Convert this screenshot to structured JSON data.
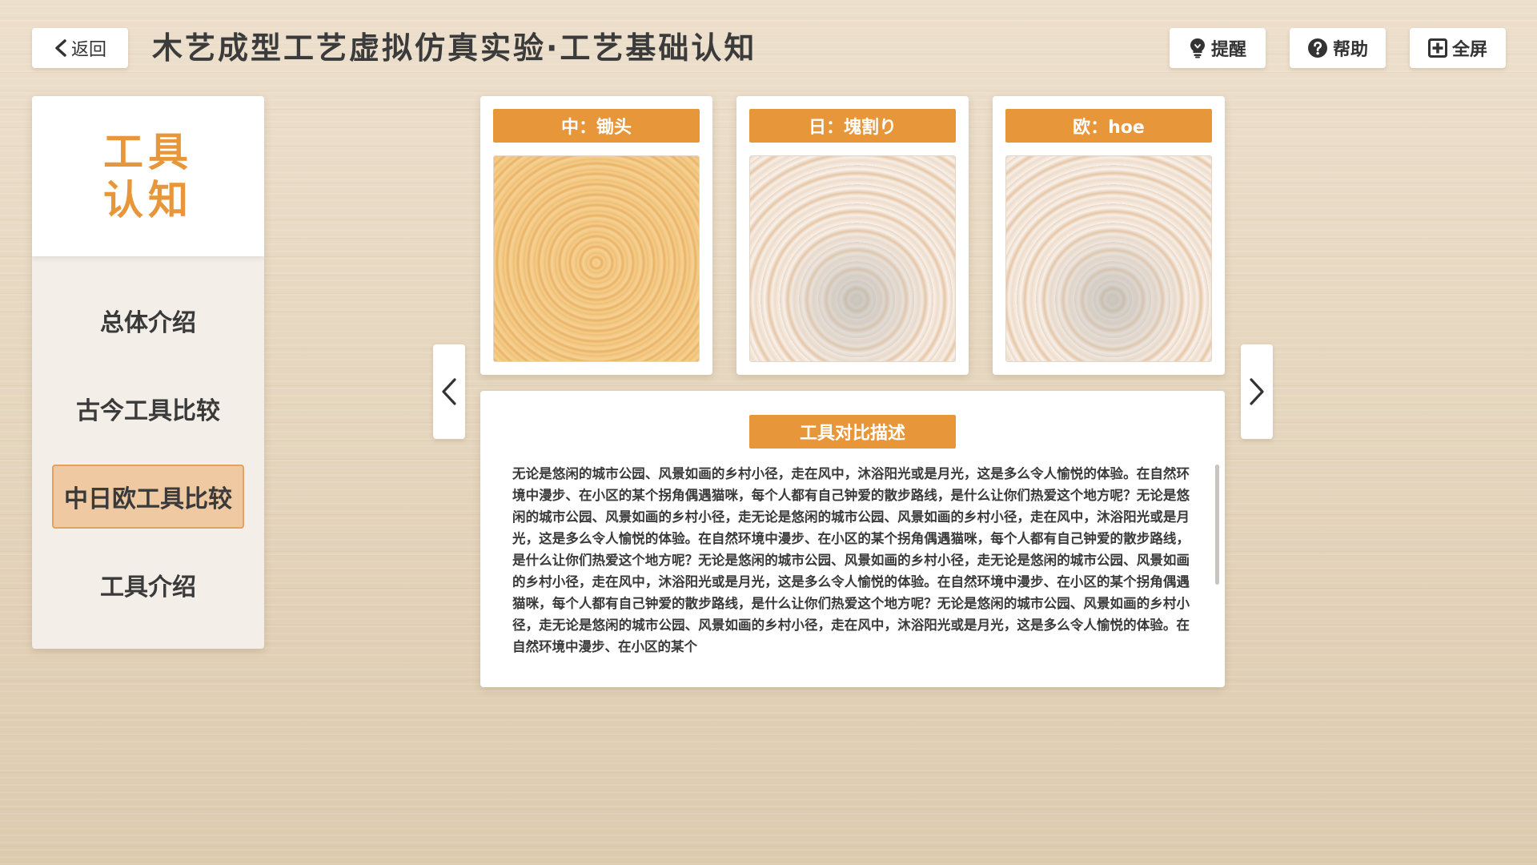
{
  "header": {
    "back_label": "返回",
    "title": "木艺成型工艺虚拟仿真实验·工艺基础认知",
    "buttons": {
      "remind": "提醒",
      "help": "帮助",
      "fullscreen": "全屏"
    }
  },
  "sidebar": {
    "heading_line1": "工具",
    "heading_line2": "认知",
    "items": [
      {
        "label": "总体介绍",
        "active": false
      },
      {
        "label": "古今工具比较",
        "active": false
      },
      {
        "label": "中日欧工具比较",
        "active": true
      },
      {
        "label": "工具介绍",
        "active": false
      }
    ]
  },
  "cards": [
    {
      "label": "中：锄头",
      "image": "wood-grain-texture"
    },
    {
      "label": "日：塊割り",
      "image": "ceramic-swirl-texture"
    },
    {
      "label": "欧：hoe",
      "image": "ceramic-swirl-texture"
    }
  ],
  "description": {
    "title": "工具对比描述",
    "text": "无论是悠闲的城市公园、风景如画的乡村小径，走在风中，沐浴阳光或是月光，这是多么令人愉悦的体验。在自然环境中漫步、在小区的某个拐角偶遇猫咪，每个人都有自己钟爱的散步路线，是什么让你们热爱这个地方呢？无论是悠闲的城市公园、风景如画的乡村小径，走无论是悠闲的城市公园、风景如画的乡村小径，走在风中，沐浴阳光或是月光，这是多么令人愉悦的体验。在自然环境中漫步、在小区的某个拐角偶遇猫咪，每个人都有自己钟爱的散步路线，是什么让你们热爱这个地方呢？无论是悠闲的城市公园、风景如画的乡村小径，走无论是悠闲的城市公园、风景如画的乡村小径，走在风中，沐浴阳光或是月光，这是多么令人愉悦的体验。在自然环境中漫步、在小区的某个拐角偶遇猫咪，每个人都有自己钟爱的散步路线，是什么让你们热爱这个地方呢？无论是悠闲的城市公园、风景如画的乡村小径，走无论是悠闲的城市公园、风景如画的乡村小径，走在风中，沐浴阳光或是月光，这是多么令人愉悦的体验。在自然环境中漫步、在小区的某个"
  },
  "icons": {
    "back": "chevron-left-icon",
    "remind": "lightbulb-icon",
    "help": "question-circle-icon",
    "fullscreen": "fullscreen-icon",
    "prev": "chevron-left-icon",
    "next": "chevron-right-icon"
  },
  "colors": {
    "accent": "#e8963a",
    "active_nav_bg": "#efc9a1",
    "active_nav_border": "#e3a160",
    "background": "#e7d9c4"
  }
}
